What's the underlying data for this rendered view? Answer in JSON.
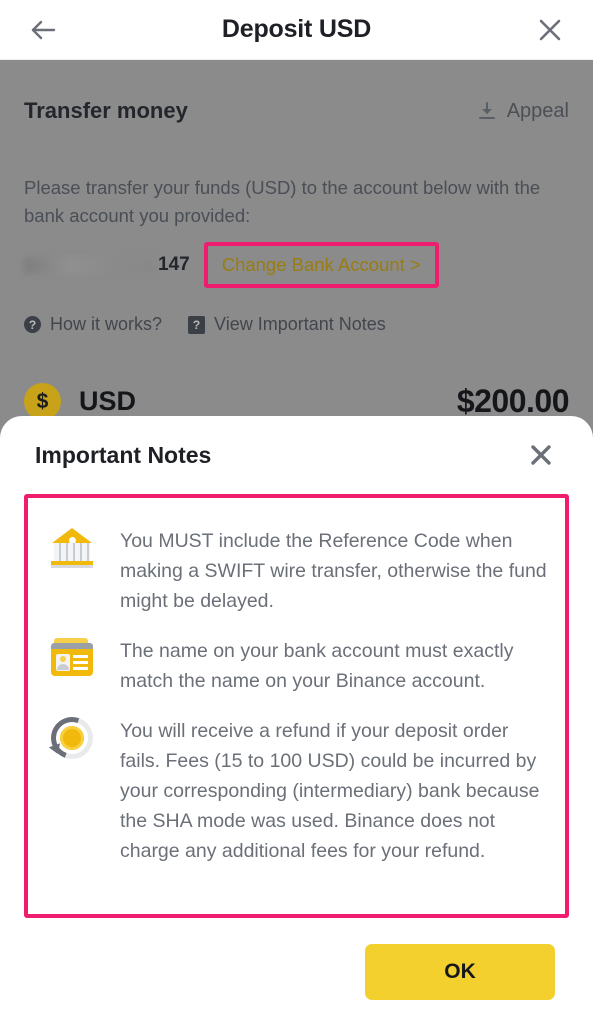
{
  "header": {
    "back_icon": "arrow-left-icon",
    "title": "Deposit USD",
    "close_icon": "close-icon"
  },
  "transfer": {
    "section_title": "Transfer money",
    "appeal_label": "Appeal",
    "appeal_icon": "download-icon",
    "instructions": "Please transfer your funds (USD) to the account below with the bank account you provided:",
    "account_masked": "",
    "account_tail": "147",
    "change_bank_label": "Change Bank Account >",
    "links": [
      {
        "label": "How it works?",
        "icon": "question-circle-icon"
      },
      {
        "label": "View Important Notes",
        "icon": "question-square-icon"
      }
    ],
    "currency_icon": "dollar-coin-icon",
    "currency_label": "USD",
    "amount": "$200.00"
  },
  "modal": {
    "title": "Important Notes",
    "close_icon": "close-icon",
    "notes": [
      {
        "icon": "bank-icon",
        "text": "You MUST include the Reference Code when making a SWIFT wire transfer, otherwise the fund might be delayed."
      },
      {
        "icon": "id-card-icon",
        "text": "The name on your bank account must exactly match the name on your Binance account."
      },
      {
        "icon": "refund-icon",
        "text": "You will receive a refund if your deposit order fails. Fees (15 to 100 USD) could be incurred by your corresponding (intermediary) bank because the SHA mode was used. Binance does not charge any additional fees for your refund."
      }
    ],
    "ok_label": "OK"
  },
  "colors": {
    "accent_yellow": "#f0b90b",
    "button_yellow": "#f3d02e",
    "annotation_pink": "#f01d6e",
    "link_gold": "#9a7d10",
    "overlay_grey": "#8b8b8b"
  }
}
